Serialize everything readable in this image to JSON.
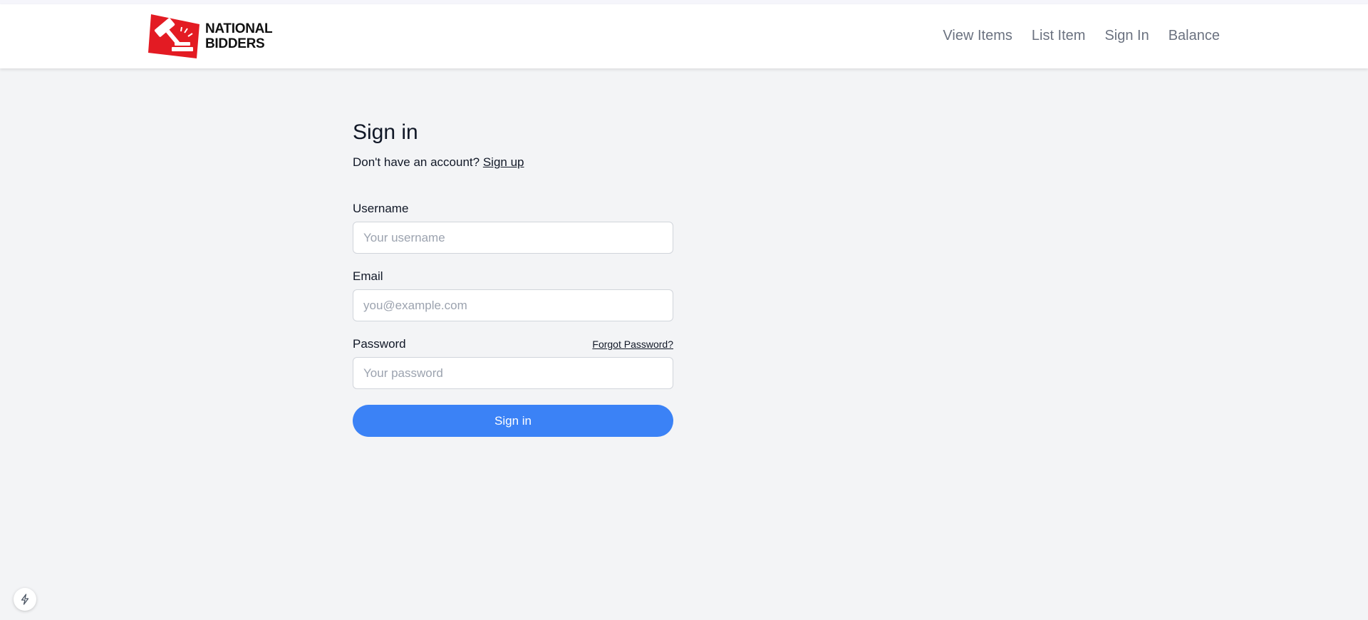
{
  "brand": {
    "logo_line1": "NATIONAL",
    "logo_line2": "BIDDERS",
    "logo_icon": "gavel-icon",
    "logo_color": "#e31b23"
  },
  "nav": {
    "items": [
      {
        "label": "View Items"
      },
      {
        "label": "List Item"
      },
      {
        "label": "Sign In"
      },
      {
        "label": "Balance"
      }
    ]
  },
  "form": {
    "title": "Sign in",
    "signup_prompt": "Don't have an account?",
    "signup_link": "Sign up",
    "username_label": "Username",
    "username_placeholder": "Your username",
    "email_label": "Email",
    "email_placeholder": "you@example.com",
    "password_label": "Password",
    "forgot_link": "Forgot Password?",
    "password_placeholder": "Your password",
    "submit_label": "Sign in"
  },
  "dev_indicator": {
    "icon": "lightning-icon"
  },
  "colors": {
    "primary_button": "#3b82f6",
    "page_background": "#f3f4f6",
    "nav_text": "#6b7280"
  }
}
